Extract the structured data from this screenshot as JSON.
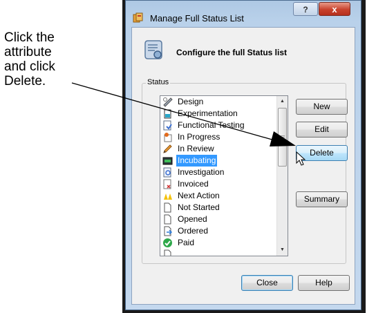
{
  "callout": {
    "lines": [
      "Click the",
      "attribute",
      "and click",
      "Delete."
    ]
  },
  "window": {
    "title": "Manage Full Status List",
    "help_glyph": "?",
    "close_glyph": "x",
    "heading": "Configure the full Status list"
  },
  "status_group": {
    "label": "Status",
    "items": [
      {
        "label": "Design",
        "icon": "design-icon"
      },
      {
        "label": "Experimentation",
        "icon": "experiment-icon"
      },
      {
        "label": "Functional Testing",
        "icon": "testing-icon"
      },
      {
        "label": "In Progress",
        "icon": "in-progress-icon"
      },
      {
        "label": "In Review",
        "icon": "pencil-icon"
      },
      {
        "label": "Incubating",
        "icon": "incubating-icon",
        "selected": true
      },
      {
        "label": "Investigation",
        "icon": "investigation-icon"
      },
      {
        "label": "Invoiced",
        "icon": "invoice-icon"
      },
      {
        "label": "Next Action",
        "icon": "next-action-icon"
      },
      {
        "label": "Not Started",
        "icon": "blank-page-icon"
      },
      {
        "label": "Opened",
        "icon": "blank-page-icon"
      },
      {
        "label": "Ordered",
        "icon": "ordered-icon"
      },
      {
        "label": "Paid",
        "icon": "checkmark-icon"
      }
    ],
    "buttons": {
      "new": "New",
      "edit": "Edit",
      "delete": "Delete",
      "summary": "Summary"
    }
  },
  "footer": {
    "close": "Close",
    "help": "Help"
  },
  "colors": {
    "selection": "#3399ff",
    "titlebar": "#b9d1ea",
    "close_button": "#c8412c"
  }
}
